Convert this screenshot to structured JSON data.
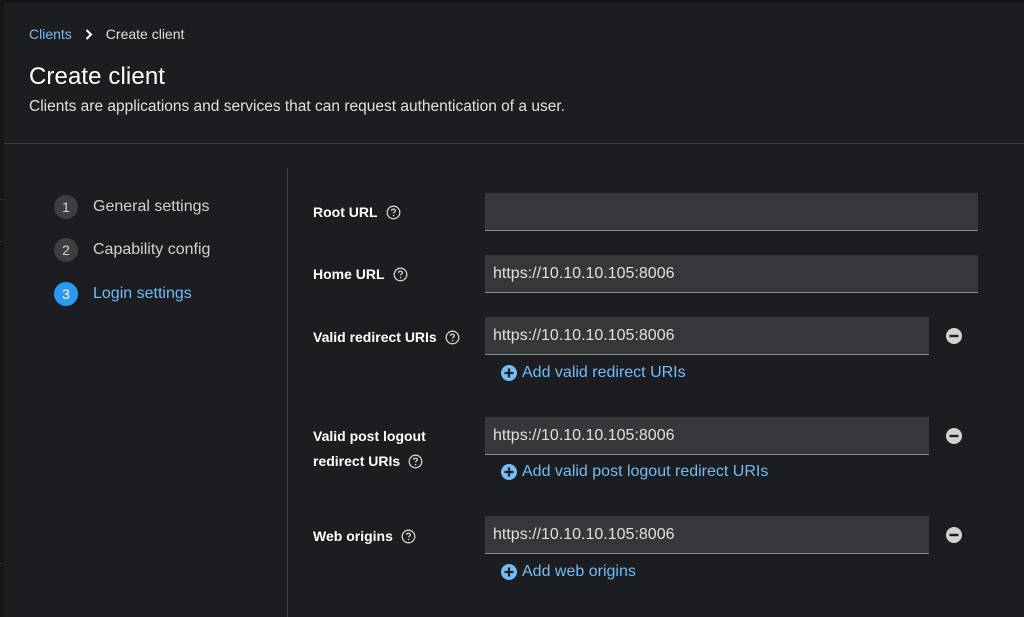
{
  "breadcrumb": {
    "parent": "Clients",
    "current": "Create client"
  },
  "header": {
    "title": "Create client",
    "description": "Clients are applications and services that can request authentication of a user."
  },
  "wizard": {
    "steps": [
      {
        "number": "1",
        "label": "General settings",
        "active": false
      },
      {
        "number": "2",
        "label": "Capability config",
        "active": false
      },
      {
        "number": "3",
        "label": "Login settings",
        "active": true
      }
    ]
  },
  "form": {
    "root_url": {
      "label": "Root URL",
      "value": ""
    },
    "home_url": {
      "label": "Home URL",
      "value": "https://10.10.10.105:8006"
    },
    "valid_redirect_uris": {
      "label": "Valid redirect URIs",
      "value": "https://10.10.10.105:8006",
      "add_label": "Add valid redirect URIs"
    },
    "valid_post_logout": {
      "label_line1": "Valid post logout",
      "label_line2": "redirect URIs",
      "value": "https://10.10.10.105:8006",
      "add_label": "Add valid post logout redirect URIs"
    },
    "web_origins": {
      "label": "Web origins",
      "value": "https://10.10.10.105:8006",
      "add_label": "Add web origins"
    }
  },
  "icons": {
    "help": "question-circle-icon",
    "remove": "minus-circle-icon",
    "add": "plus-circle-icon",
    "breadcrumb_separator": "chevron-right-icon"
  },
  "colors": {
    "background": "#1b1d21",
    "link": "#73bcf7",
    "active_step": "#2b9af3",
    "input_background": "#36373a"
  }
}
